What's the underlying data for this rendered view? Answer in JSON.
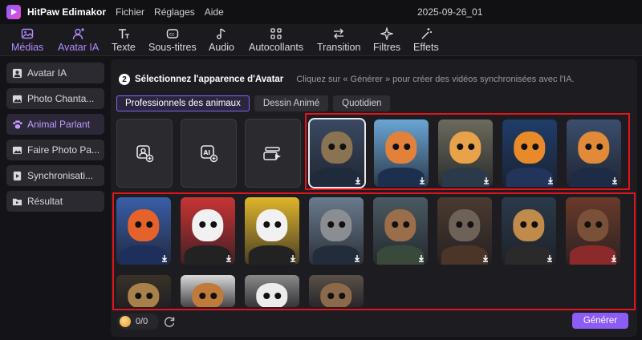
{
  "app": {
    "name": "HitPaw Edimakor",
    "document_title": "2025-09-26_01"
  },
  "menu": [
    "Fichier",
    "Réglages",
    "Aide"
  ],
  "toolbar": [
    {
      "label": "Médias",
      "icon": "image-icon"
    },
    {
      "label": "Avatar IA",
      "icon": "avatar-icon",
      "active": true
    },
    {
      "label": "Texte",
      "icon": "text-icon"
    },
    {
      "label": "Sous-titres",
      "icon": "subtitles-icon"
    },
    {
      "label": "Audio",
      "icon": "music-note-icon"
    },
    {
      "label": "Autocollants",
      "icon": "stickers-icon"
    },
    {
      "label": "Transition",
      "icon": "transition-arrows-icon"
    },
    {
      "label": "Filtres",
      "icon": "sparkle-filter-icon"
    },
    {
      "label": "Effets",
      "icon": "effects-wand-icon"
    }
  ],
  "sidebar": [
    {
      "label": "Avatar IA",
      "icon": "avatar-icon"
    },
    {
      "label": "Photo Chanta...",
      "icon": "photo-icon"
    },
    {
      "label": "Animal Parlant",
      "icon": "paw-icon",
      "active": true
    },
    {
      "label": "Faire Photo Pa...",
      "icon": "photo-icon"
    },
    {
      "label": "Synchronisati...",
      "icon": "sync-icon"
    },
    {
      "label": "Résultat",
      "icon": "play-folder-icon"
    }
  ],
  "step": {
    "number": "2",
    "title": "Sélectionnez l'apparence d'Avatar",
    "hint": "Cliquez sur « Générer » pour créer des vidéos synchronisées avec l'IA."
  },
  "tabs": [
    {
      "label": "Professionnels des animaux",
      "active": true
    },
    {
      "label": "Dessin Animé"
    },
    {
      "label": "Quotidien"
    }
  ],
  "action_cards": [
    {
      "icon": "upload-avatar-icon"
    },
    {
      "icon": "ai-image-add-icon"
    },
    {
      "icon": "video-avatar-icon"
    }
  ],
  "avatars": [
    {
      "name": "cat-tabby-suit",
      "bg": "#3a4a62",
      "face": "#8a7352",
      "suit": "#1f2a3c",
      "selected": true
    },
    {
      "name": "cat-orange-suit",
      "bg": "#6aa6d6",
      "face": "#e2823a",
      "suit": "#1c2f4f"
    },
    {
      "name": "cat-cartoon-orange",
      "bg": "#6b6a5c",
      "face": "#e7a24a",
      "suit": "#2a3a4a"
    },
    {
      "name": "fox-cartoon",
      "bg": "#1f3d6b",
      "face": "#e88a2a",
      "suit": "#22345a"
    },
    {
      "name": "fox-corgi-cartoon",
      "bg": "#3a4e6e",
      "face": "#e08a3a",
      "suit": "#1e2b44"
    },
    {
      "name": "fox-red-suit",
      "bg": "#3a5ea8",
      "face": "#e5622a",
      "suit": "#1e2f5c"
    },
    {
      "name": "panda-red",
      "bg": "#c83434",
      "face": "#f1f1f1",
      "suit": "#222222"
    },
    {
      "name": "panda-yellow",
      "bg": "#e0b52c",
      "face": "#f1f1f1",
      "suit": "#222222"
    },
    {
      "name": "raccoon-suit",
      "bg": "#6a7b8e",
      "face": "#8a8d92",
      "suit": "#222c3a"
    },
    {
      "name": "kangaroo-suit",
      "bg": "#4a5a62",
      "face": "#9a6e4a",
      "suit": "#3a4a3a"
    },
    {
      "name": "wolf-suit",
      "bg": "#4a3a30",
      "face": "#6e6258",
      "suit": "#4a3528"
    },
    {
      "name": "leopard-suit",
      "bg": "#2a3a4a",
      "face": "#c08a4a",
      "suit": "#2a2a2a"
    },
    {
      "name": "bear-suit",
      "bg": "#6a3a2a",
      "face": "#7a5038",
      "suit": "#8a2a2a"
    },
    {
      "name": "lion",
      "bg": "#3a3228",
      "face": "#a8804a",
      "suit": "#3a3228"
    },
    {
      "name": "dog-cap",
      "bg": "#d8d8d8",
      "face": "#c07a3a",
      "suit": "#444444"
    },
    {
      "name": "panda-sunglasses",
      "bg": "#8a8a8a",
      "face": "#ececec",
      "suit": "#333333"
    },
    {
      "name": "otter",
      "bg": "#5a5048",
      "face": "#8a6a4a",
      "suit": "#3a3028"
    }
  ],
  "credits": {
    "value": "0/0"
  },
  "generate_label": "Générer",
  "colors": {
    "accent": "#8b5cf6",
    "highlight": "#e3141c",
    "background": "#141418"
  }
}
